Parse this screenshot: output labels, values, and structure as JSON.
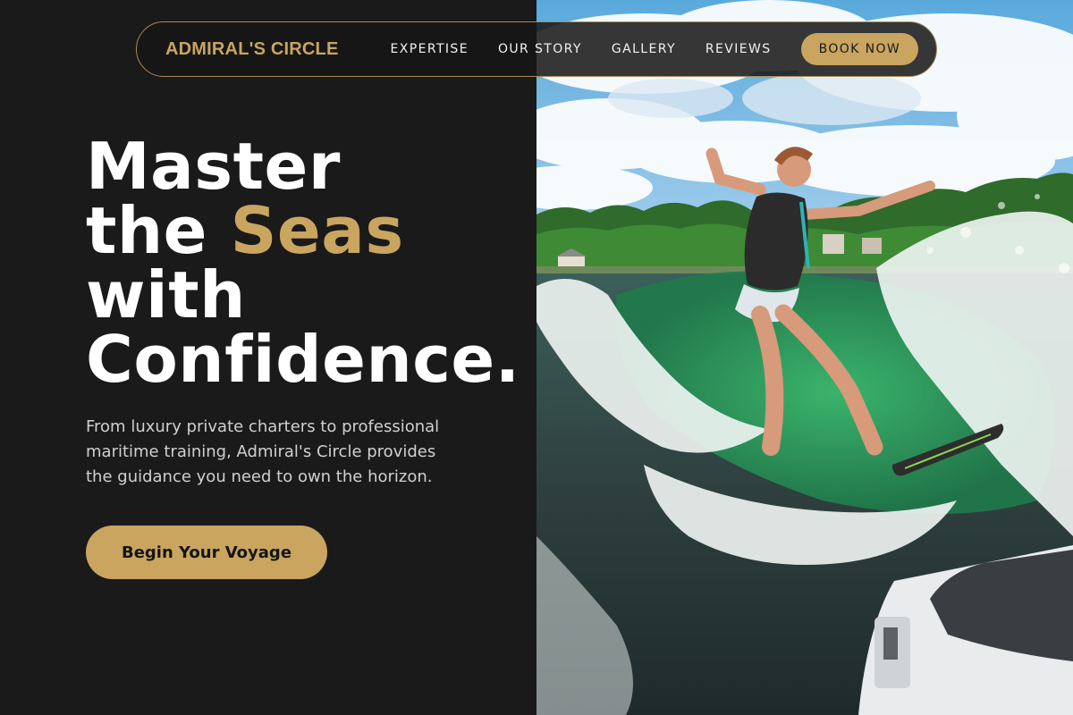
{
  "brand": {
    "name": "ADMIRAL'S CIRCLE"
  },
  "nav": {
    "links": [
      "EXPERTISE",
      "OUR STORY",
      "GALLERY",
      "REVIEWS"
    ],
    "book_label": "BOOK NOW"
  },
  "hero": {
    "headline": {
      "line1": "Master",
      "line2_prefix": "the ",
      "line2_accent": "Seas",
      "line3": "with",
      "line4": "Confidence."
    },
    "subtext": "From luxury private charters to professional maritime training, Admiral's Circle provides the guidance you need to own the horizon.",
    "cta_label": "Begin Your Voyage",
    "image_description": "wakesurfer-on-lake-photo"
  },
  "colors": {
    "background": "#1a1a1a",
    "accent_gold": "#c9a55f",
    "text_white": "#ffffff",
    "text_muted": "#d0d0d0"
  }
}
